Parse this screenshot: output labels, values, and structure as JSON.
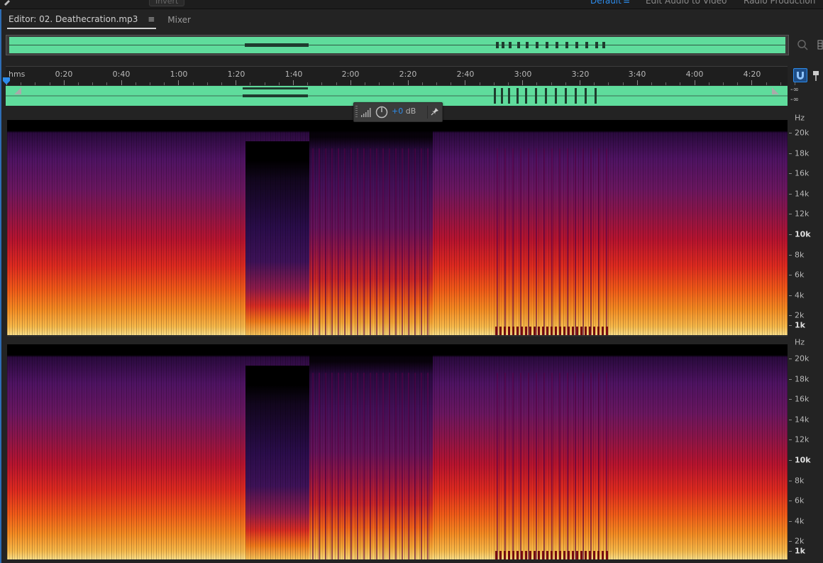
{
  "topbar": {
    "menu_item": "Invert",
    "workspaces": [
      {
        "label": "Default",
        "active": true
      },
      {
        "label": "Edit Audio to Video",
        "active": false
      },
      {
        "label": "Radio Production",
        "active": false
      }
    ]
  },
  "editor": {
    "tabs": [
      {
        "label": "Editor: 02. Deathecration.mp3",
        "active": true,
        "menu_icon": "≡"
      },
      {
        "label": "Mixer",
        "active": false
      }
    ]
  },
  "ruler": {
    "unit": "hms",
    "labels": [
      "0:20",
      "0:40",
      "1:00",
      "1:20",
      "1:40",
      "2:00",
      "2:20",
      "2:40",
      "3:00",
      "3:20",
      "3:40",
      "4:00",
      "4:20"
    ]
  },
  "meters": {
    "db_top": "-∞",
    "db_bottom": "-∞"
  },
  "hud": {
    "value": "+0",
    "unit": "dB"
  },
  "spectral_scale": {
    "unit": "Hz",
    "labels": [
      "20k",
      "18k",
      "16k",
      "14k",
      "12k",
      "10k",
      "8k",
      "6k",
      "4k",
      "2k",
      "1k"
    ],
    "bold": [
      "10k",
      "1k"
    ]
  },
  "colors": {
    "accent": "#2d8ceb",
    "waveform": "#5fdc9c",
    "spectrogram_low": "#f4c25a",
    "spectrogram_mid": "#e0242a",
    "spectrogram_high": "#5a1a6e"
  },
  "icons": {
    "tab_menu": "menu-icon",
    "zoom": "zoom-icon",
    "snap": "magnet-icon",
    "marker": "marker-icon",
    "playhead": "playhead-icon",
    "hud_knob": "volume-knob-icon",
    "hud_pin": "pin-icon",
    "hud_meter": "level-meter-icon"
  }
}
